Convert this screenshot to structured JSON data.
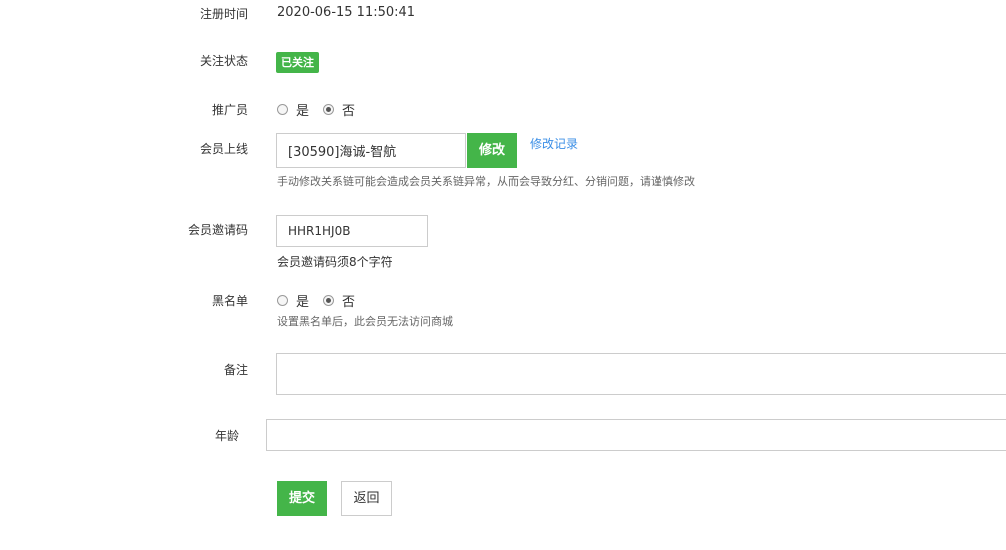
{
  "form": {
    "register_time": {
      "label": "注册时间",
      "value": "2020-06-15 11:50:41"
    },
    "follow_status": {
      "label": "关注状态",
      "badge": "已关注"
    },
    "promoter": {
      "label": "推广员",
      "options": [
        "是",
        "否"
      ],
      "selected": "否"
    },
    "upline": {
      "label": "会员上线",
      "value": "[30590]海诚-智航",
      "button": "修改",
      "history_link": "修改记录",
      "hint": "手动修改关系链可能会造成会员关系链异常，从而会导致分红、分销问题，请谨慎修改"
    },
    "invite_code": {
      "label": "会员邀请码",
      "value": "HHR1HJ0B",
      "hint": "会员邀请码须8个字符"
    },
    "blacklist": {
      "label": "黑名单",
      "options": [
        "是",
        "否"
      ],
      "selected": "否",
      "hint": "设置黑名单后，此会员无法访问商城"
    },
    "remark": {
      "label": "备注",
      "value": ""
    },
    "age": {
      "label": "年龄",
      "value": ""
    },
    "actions": {
      "submit": "提交",
      "back": "返回"
    }
  },
  "colors": {
    "primary_green": "#44b549",
    "link_blue": "#3a8ee6"
  }
}
